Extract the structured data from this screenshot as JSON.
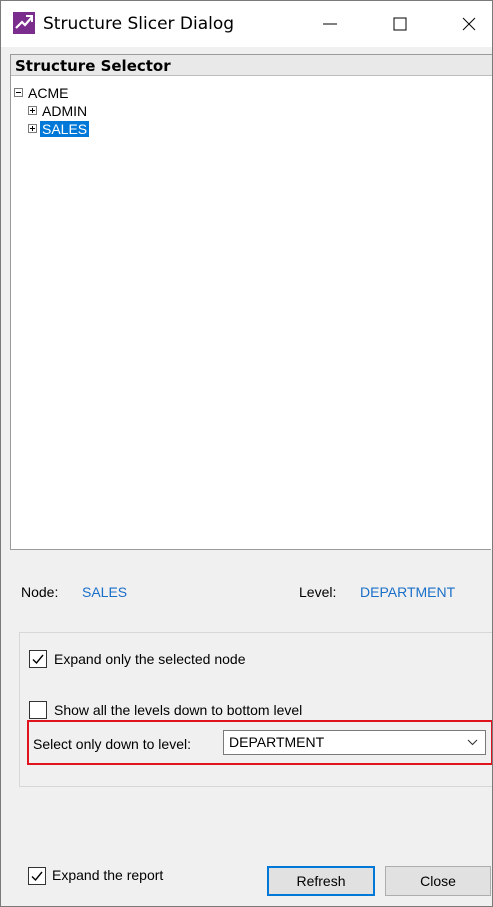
{
  "window": {
    "title": "Structure Slicer Dialog"
  },
  "tree": {
    "header": "Structure Selector",
    "root": {
      "label": "ACME",
      "expanded": true
    },
    "children": [
      {
        "label": "ADMIN",
        "selected": false
      },
      {
        "label": "SALES",
        "selected": true
      }
    ]
  },
  "info": {
    "node_label": "Node:",
    "node_value": "SALES",
    "level_label": "Level:",
    "level_value": "DEPARTMENT"
  },
  "options": {
    "expand_selected": {
      "label": "Expand only the selected node",
      "checked": true
    },
    "show_all_levels": {
      "label": "Show all the levels down to bottom level",
      "checked": false
    },
    "level_select": {
      "label": "Select only down to level:",
      "value": "DEPARTMENT"
    }
  },
  "footer": {
    "expand_report": {
      "label": "Expand the report",
      "checked": true
    },
    "refresh_label": "Refresh",
    "close_label": "Close"
  },
  "colors": {
    "accent": "#0078d7",
    "link": "#1a6fc9",
    "highlight_border": "#e0141e"
  },
  "icons": [
    "app-icon",
    "minimize-icon",
    "maximize-icon",
    "close-icon",
    "collapse-icon",
    "expand-icon",
    "checkmark-icon",
    "chevron-down-icon"
  ]
}
